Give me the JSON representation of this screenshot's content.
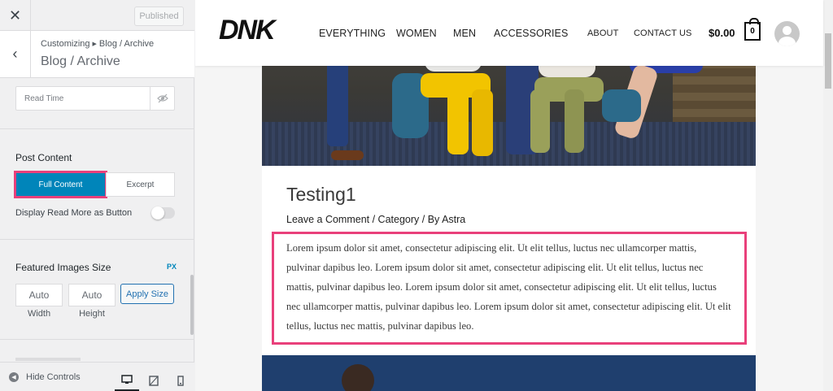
{
  "topbar": {
    "close_icon": "close-icon",
    "publish_label": "Published"
  },
  "section": {
    "breadcrumb_root": "Customizing",
    "breadcrumb_current": "Blog / Archive",
    "title": "Blog / Archive"
  },
  "controls": {
    "read_time_label": "Read Time",
    "post_content_label": "Post Content",
    "post_content_options": [
      "Full Content",
      "Excerpt"
    ],
    "post_content_selected": "Full Content",
    "read_more_label": "Display Read More as Button",
    "read_more_enabled": false,
    "featured_images_label": "Featured Images Size",
    "unit_label": "PX",
    "width_value": "Auto",
    "height_value": "Auto",
    "width_caption": "Width",
    "height_caption": "Height",
    "apply_label": "Apply Size"
  },
  "footer": {
    "hide_controls_label": "Hide Controls"
  },
  "site": {
    "logo": "DNK",
    "nav_main": [
      "EVERYTHING",
      "WOMEN",
      "MEN",
      "ACCESSORIES"
    ],
    "nav_secondary": [
      "ABOUT",
      "CONTACT US"
    ],
    "cart_total": "$0.00",
    "cart_count": "0"
  },
  "post": {
    "title": "Testing1",
    "meta": "Leave a Comment / Category / By Astra",
    "content": "Lorem ipsum dolor sit amet, consectetur adipiscing elit. Ut elit tellus, luctus nec ullamcorper mattis, pulvinar dapibus leo. Lorem ipsum dolor sit amet, consectetur adipiscing elit. Ut elit tellus, luctus nec mattis, pulvinar dapibus leo. Lorem ipsum dolor sit amet, consectetur adipiscing elit. Ut elit tellus, luctus nec ullamcorper mattis, pulvinar dapibus leo. Lorem ipsum dolor sit amet, consectetur adipiscing elit. Ut elit tellus, luctus nec mattis, pulvinar dapibus leo."
  },
  "colors": {
    "accent": "#0085ba",
    "highlight": "#e9407b"
  }
}
